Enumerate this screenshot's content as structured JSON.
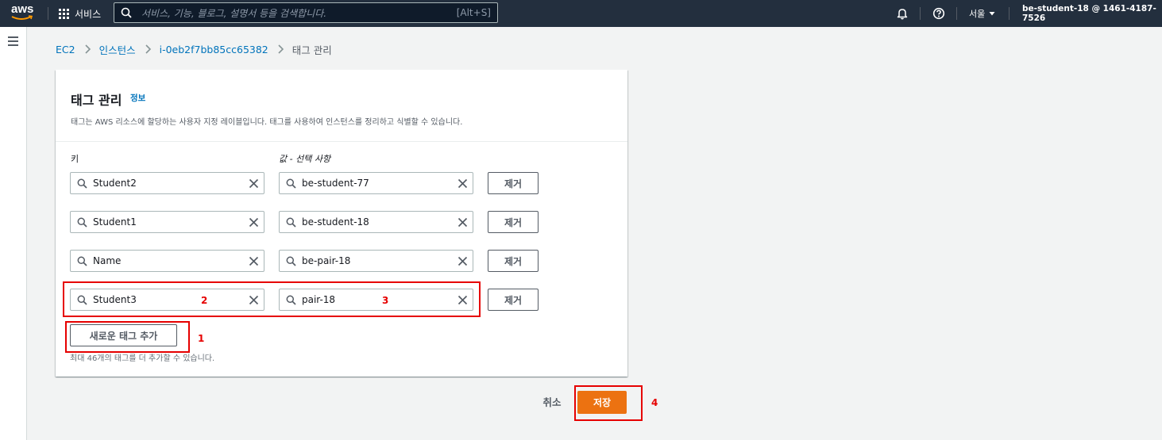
{
  "nav": {
    "logo_text": "aws",
    "services_label": "서비스",
    "search_placeholder": "서비스, 기능, 블로그, 설명서 등을 검색합니다.",
    "search_shortcut": "[Alt+S]",
    "region": "서울",
    "account": "be-student-18 @ 1461-4187-7526"
  },
  "breadcrumb": {
    "items": [
      "EC2",
      "인스턴스",
      "i-0eb2f7bb85cc65382"
    ],
    "current": "태그 관리"
  },
  "panel": {
    "title": "태그 관리",
    "info_link": "정보",
    "description": "태그는 AWS 리소스에 할당하는 사용자 지정 레이블입니다. 태그를 사용하여 인스턴스를 정리하고 식별할 수 있습니다.",
    "key_label": "키",
    "value_label": "값 - 선택 사항",
    "tags": [
      {
        "key": "Student2",
        "value": "be-student-77"
      },
      {
        "key": "Student1",
        "value": "be-student-18"
      },
      {
        "key": "Name",
        "value": "be-pair-18"
      },
      {
        "key": "Student3",
        "value": "pair-18"
      }
    ],
    "remove_label": "제거",
    "add_tag_label": "새로운 태그 추가",
    "limit_text": "최대 46개의 태그를 더 추가할 수 있습니다."
  },
  "footer": {
    "cancel_label": "취소",
    "save_label": "저장"
  },
  "annotations": [
    "1",
    "2",
    "3",
    "4"
  ],
  "colors": {
    "nav_bg": "#232f3e",
    "link": "#0073bb",
    "primary_button": "#ec7211",
    "annotation": "#e60000",
    "page_bg": "#f2f3f3"
  }
}
